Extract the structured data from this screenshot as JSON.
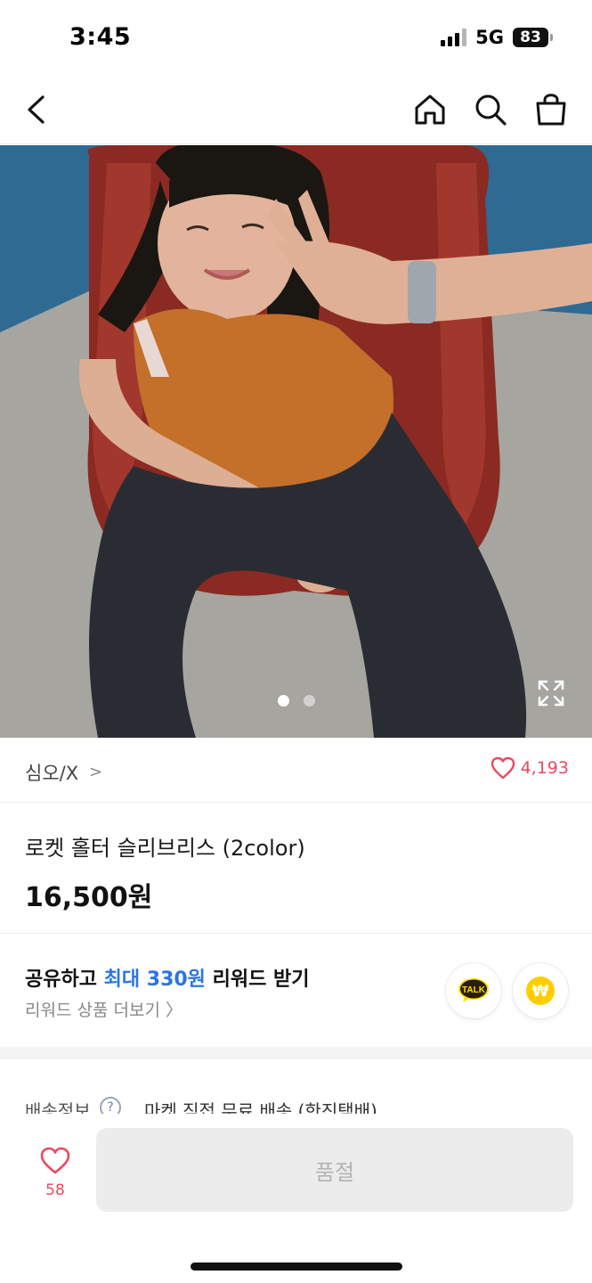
{
  "status_bar": {
    "time": "3:45",
    "network": "5G",
    "battery": "83"
  },
  "nav": {
    "icons": [
      "back-arrow-icon",
      "home-icon",
      "search-icon",
      "shopping-bag-icon"
    ]
  },
  "gallery": {
    "image_alt": "Product photo: model wearing orange ribbed halter top and dark jeans",
    "current_slide": 1,
    "total_slides": 2
  },
  "brand": {
    "name": "심오/X",
    "chevron": ">",
    "like_count": "4,193"
  },
  "product": {
    "title": "로켓 홀터 슬리브리스 (2color)",
    "price": "16,500원"
  },
  "reward": {
    "headline_prefix": "공유하고 ",
    "headline_accent": "최대 330원",
    "headline_suffix": " 리워드 받기",
    "link": "리워드 상품 더보기 〉",
    "kakao_label": "TALK",
    "won_symbol": "₩"
  },
  "delivery": {
    "label": "배송정보",
    "help": "?",
    "value": "마켓 직접 무료 배송 (한진택배)"
  },
  "bottom_bar": {
    "wish_count": "58",
    "buy_label": "품절"
  },
  "colors": {
    "accent_pink": "#e84a5f",
    "accent_blue": "#2a76e0",
    "kakao_yellow": "#fae100",
    "won_yellow": "#ffcd00"
  }
}
